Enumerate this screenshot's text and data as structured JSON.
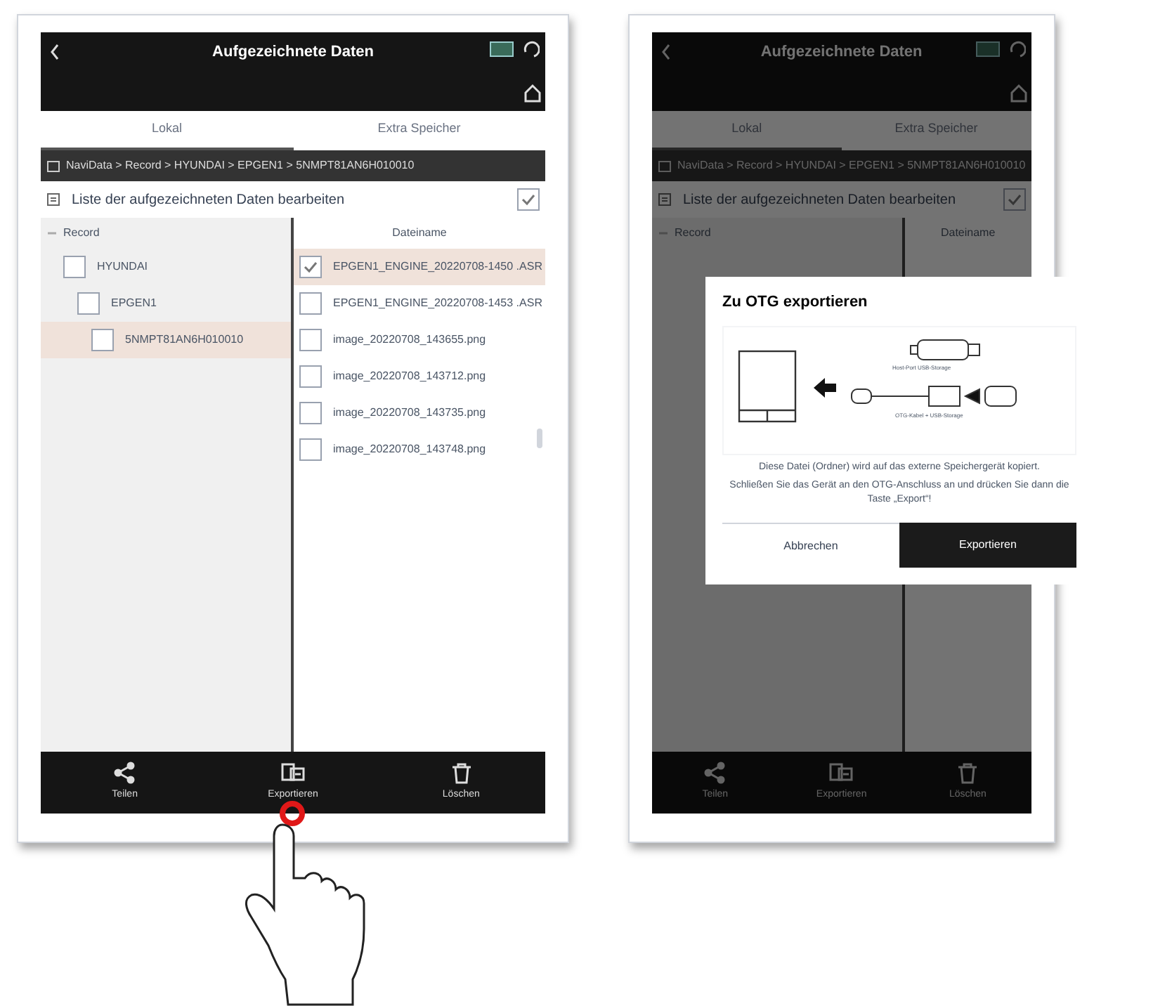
{
  "screens": [
    {
      "title": "Aufgezeichnete Daten",
      "dimmed": false,
      "tabs": [
        {
          "label": "Lokal",
          "selected": true
        },
        {
          "label": "Extra Speicher",
          "selected": false
        }
      ],
      "breadcrumb": "NaviData > Record > HYUNDAI > EPGEN1 > 5NMPT81AN6H010010",
      "edit_label": "Liste der aufgezeichneten Daten bearbeiten",
      "select_all_checked": true,
      "tree_header": "Record",
      "files_header": "Dateiname",
      "tree": [
        {
          "label": "HYUNDAI",
          "checked": false,
          "selected": false,
          "children": [
            {
              "label": "EPGEN1",
              "checked": false,
              "selected": false,
              "children": [
                {
                  "label": "5NMPT81AN6H010010",
                  "checked": false,
                  "selected": true
                }
              ]
            }
          ]
        }
      ],
      "files": [
        {
          "label": "EPGEN1_ENGINE_20220708-1450 .ASR",
          "checked": true,
          "selected": true
        },
        {
          "label": "EPGEN1_ENGINE_20220708-1453 .ASR",
          "checked": false,
          "selected": false
        },
        {
          "label": "image_20220708_143655.png",
          "checked": false,
          "selected": false
        },
        {
          "label": "image_20220708_143712.png",
          "checked": false,
          "selected": false
        },
        {
          "label": "image_20220708_143735.png",
          "checked": false,
          "selected": false
        },
        {
          "label": "image_20220708_143748.png",
          "checked": false,
          "selected": false
        }
      ],
      "toolbar": [
        {
          "kind": "share",
          "label": "Teilen",
          "touched": false
        },
        {
          "kind": "export",
          "label": "Exportieren",
          "touched": true
        },
        {
          "kind": "delete",
          "label": "Löschen",
          "touched": false
        }
      ]
    },
    {
      "title": "Aufgezeichnete Daten",
      "dimmed": true,
      "tabs": [
        {
          "label": "Lokal",
          "selected": true
        },
        {
          "label": "Extra Speicher",
          "selected": false
        }
      ],
      "breadcrumb": "NaviData > Record > HYUNDAI > EPGEN1 > 5NMPT81AN6H010010",
      "edit_label": "Liste der aufgezeichneten Daten bearbeiten",
      "select_all_checked": true,
      "tree_header": "Record",
      "files_header": "Dateiname",
      "toolbar": [
        {
          "kind": "share",
          "label": "Teilen",
          "touched": false
        },
        {
          "kind": "export",
          "label": "Exportieren",
          "touched": false
        },
        {
          "kind": "delete",
          "label": "Löschen",
          "touched": false
        }
      ],
      "dialog": {
        "title": "Zu OTG exportieren",
        "host_label": "Host-Port USB-Storage",
        "otg_label": "OTG-Kabel + USB-Storage",
        "message": "Diese Datei (Ordner) wird auf das externe Speichergerät kopiert.\nSchließen Sie das Gerät an den OTG-Anschluss an und drücken Sie dann die Taste „Export“!",
        "buttons": [
          {
            "kind": "secondary",
            "label": "Abbrechen"
          },
          {
            "kind": "primary",
            "label": "Exportieren"
          }
        ]
      }
    }
  ]
}
